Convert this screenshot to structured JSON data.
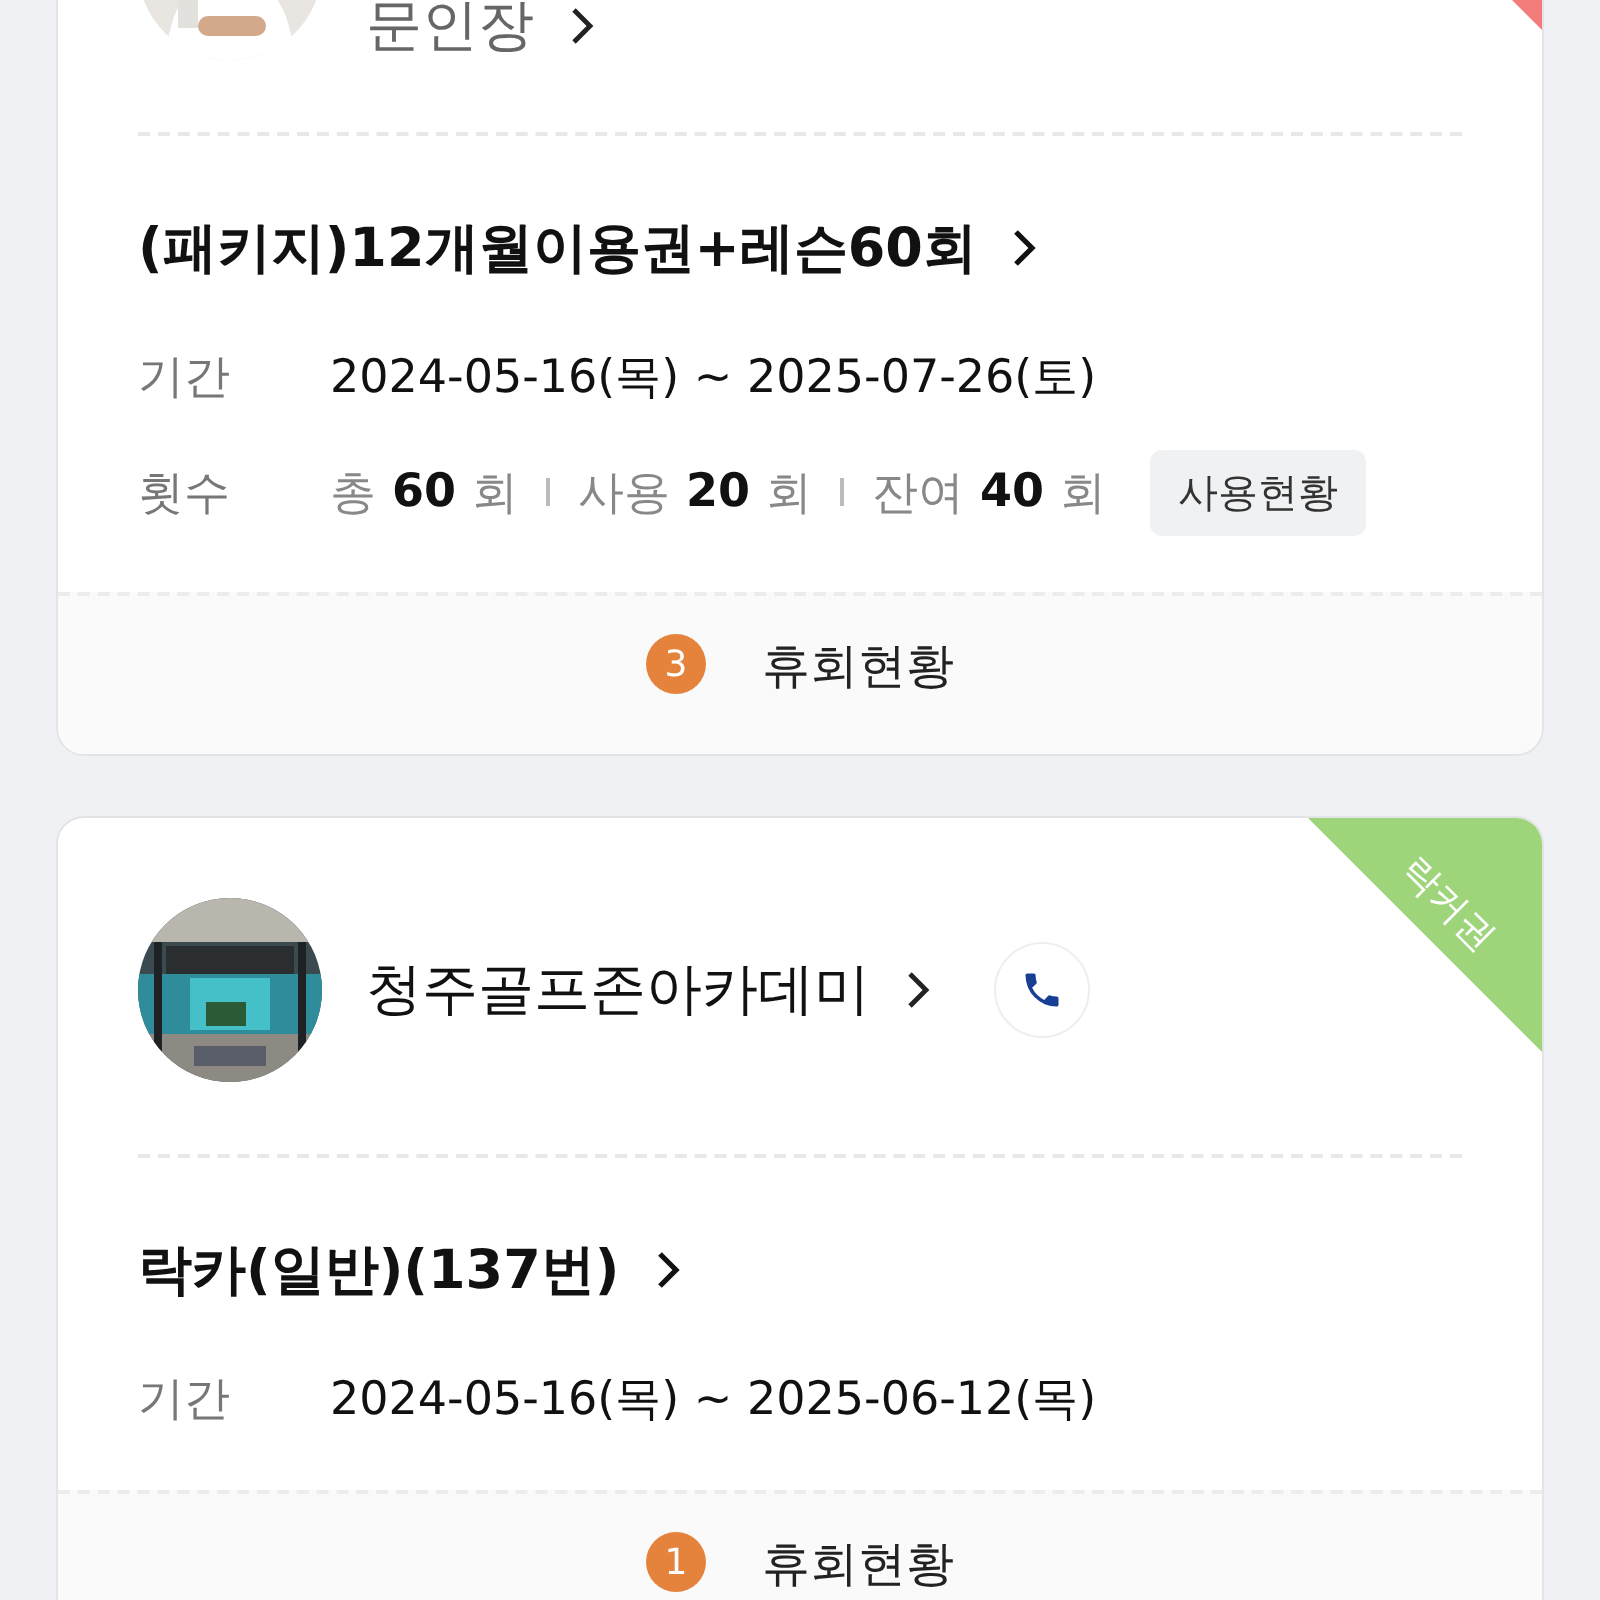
{
  "cards": [
    {
      "ribbon": {
        "color": "#f27c7c"
      },
      "name": "문인장",
      "dimmed": true,
      "phone": false,
      "title": "(패키지)12개월이용권+레슨60회",
      "period_label": "기간",
      "period": "2024-05-16(목) ~ 2025-07-26(토)",
      "count_label": "횟수",
      "counts": [
        {
          "label": "총",
          "value": "60",
          "unit": "회"
        },
        {
          "label": "사용",
          "value": "20",
          "unit": "회"
        },
        {
          "label": "잔여",
          "value": "40",
          "unit": "회"
        }
      ],
      "usage_button": "사용현황",
      "footer": {
        "badge": "3",
        "label": "휴회현황"
      }
    },
    {
      "ribbon": {
        "color": "#9ed57a",
        "label": "락커권"
      },
      "name": "청주골프존아카데미",
      "dimmed": false,
      "phone": true,
      "title": "락카(일반)(137번)",
      "period_label": "기간",
      "period": "2024-05-16(목) ~ 2025-06-12(목)",
      "footer": {
        "badge": "1",
        "label": "휴회현황"
      }
    }
  ]
}
